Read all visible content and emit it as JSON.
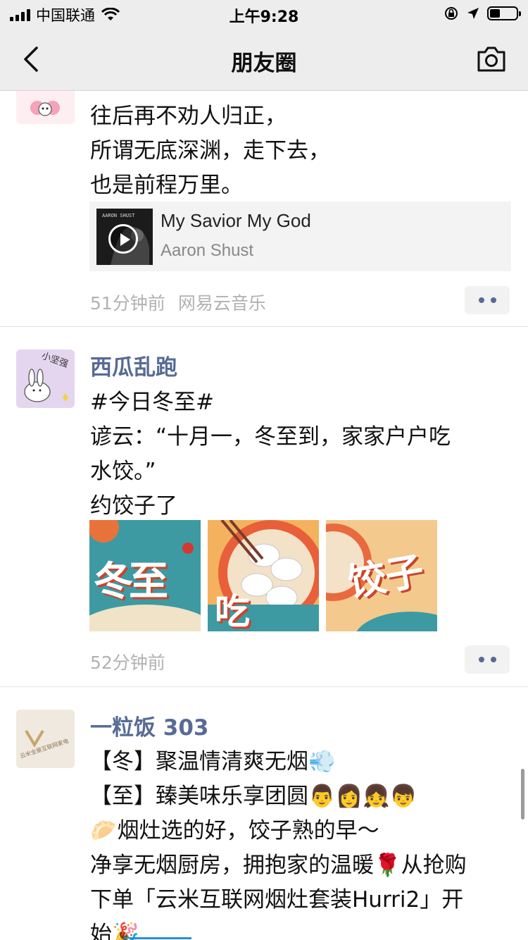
{
  "status_bar": {
    "carrier": "中国联通",
    "time": "上午9:28"
  },
  "nav": {
    "title": "朋友圈"
  },
  "posts": [
    {
      "text_lines": [
        "往后再不劝人归正，",
        "所谓无底深渊，走下去，",
        "也是前程万里。"
      ],
      "music": {
        "cover_text": "AARON SHUST",
        "title": "My Savior My God",
        "artist": "Aaron Shust"
      },
      "time": "51分钟前",
      "source": "网易云音乐"
    },
    {
      "name": "西瓜乱跑",
      "avatar_text": "小坚强",
      "text_lines": [
        "#今日冬至#",
        "谚云：“十月一，冬至到，家家户户吃",
        "水饺。”",
        "约饺子了"
      ],
      "images": [
        {
          "text": "冬至",
          "sub": "冬至"
        },
        {
          "text": "吃",
          "sub": ""
        },
        {
          "text": "饺子",
          "sub": ""
        }
      ],
      "time": "52分钟前"
    },
    {
      "name": "一粒饭 303",
      "avatar_text": "云米全屋互联网家电",
      "text_lines": [
        "【冬】聚温情清爽无烟💨",
        "【至】臻美味乐享团圆👨👩👧👦",
        "🥟烟灶选的好，饺子熟的早～",
        "净享无烟厨房，拥抱家的温暖🌹从抢购",
        "下单「云米互联网烟灶套装Hurri2」开",
        "始🎉"
      ]
    }
  ],
  "colors": {
    "name": "#576b95",
    "time": "#b2b2b2",
    "bar": "#ededed"
  }
}
